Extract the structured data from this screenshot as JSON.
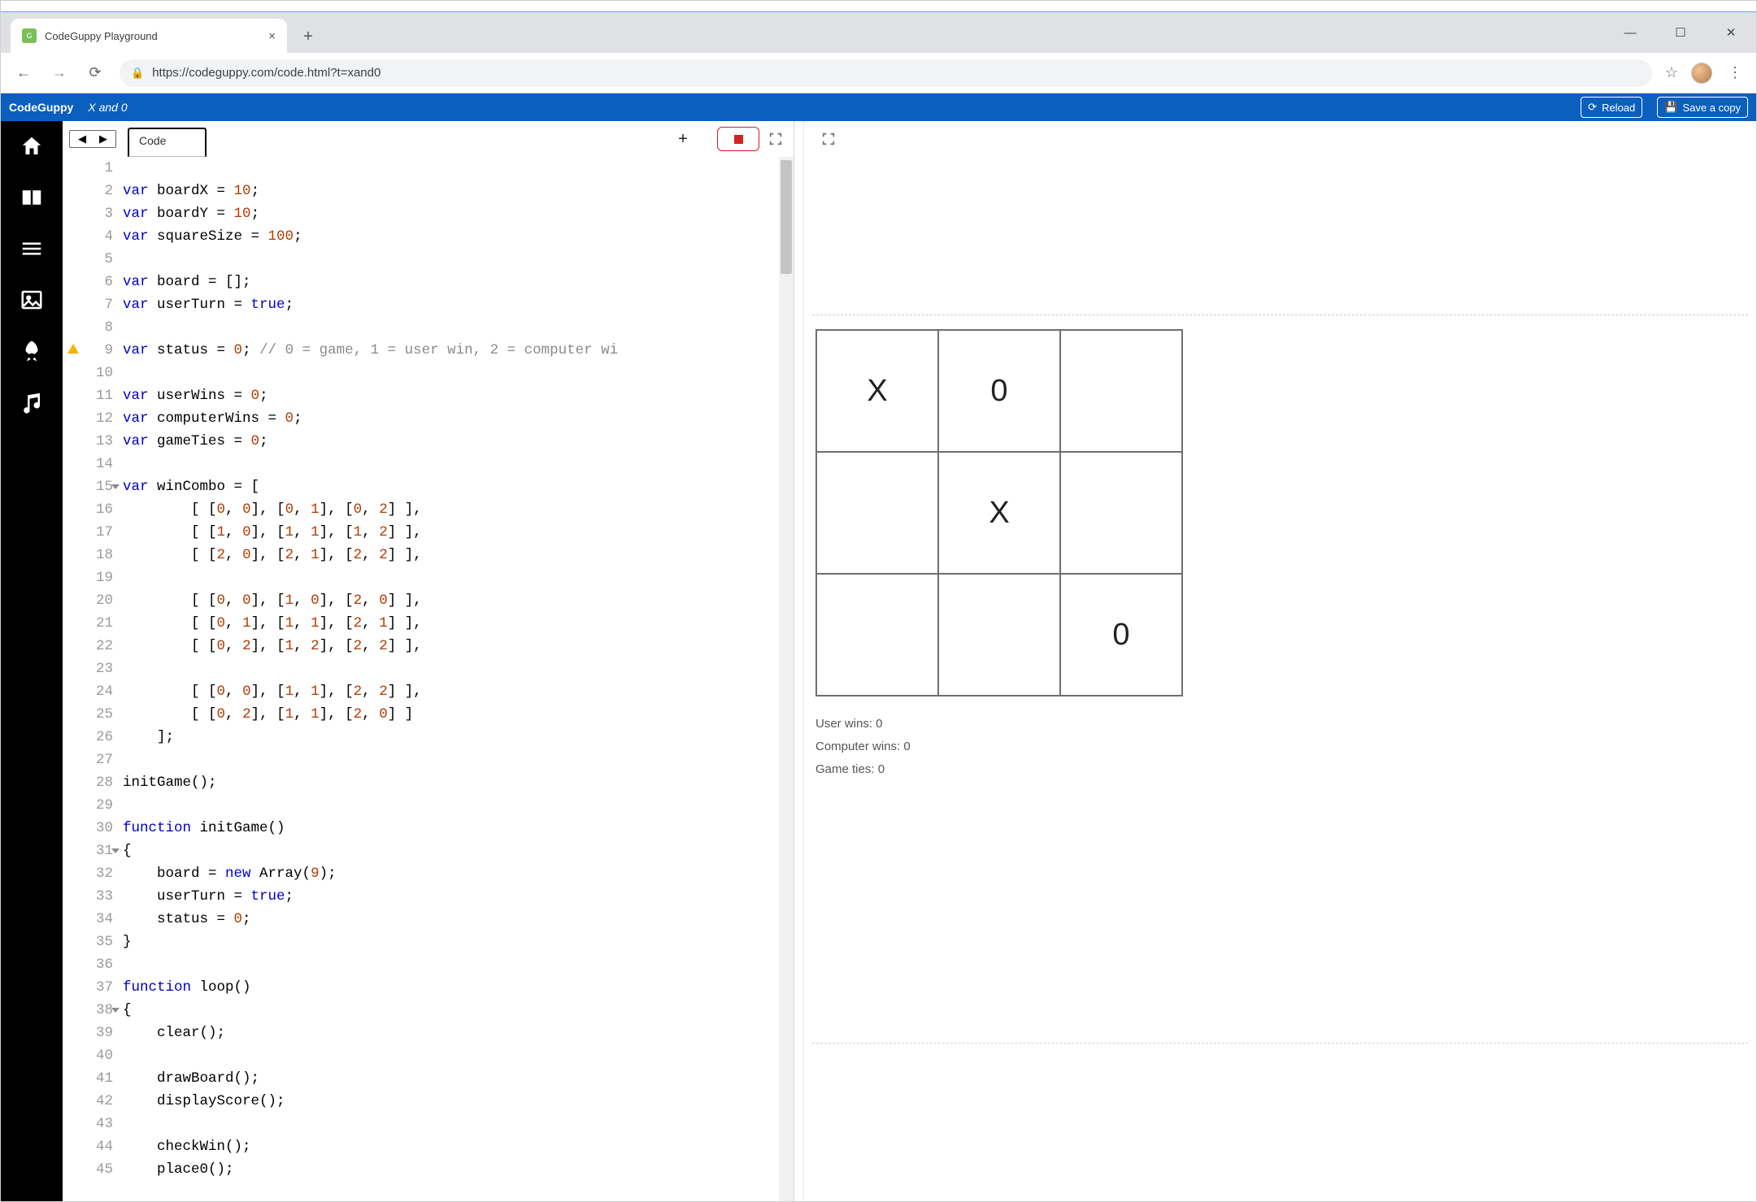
{
  "browser": {
    "tab_title": "CodeGuppy Playground",
    "url": "https://codeguppy.com/code.html?t=xand0"
  },
  "header": {
    "brand": "CodeGuppy",
    "project": "X and 0",
    "reload": "Reload",
    "save": "Save a copy"
  },
  "editor": {
    "tab_label": "Code",
    "lines": [
      "",
      "var boardX = 10;",
      "var boardY = 10;",
      "var squareSize = 100;",
      "",
      "var board = [];",
      "var userTurn = true;",
      "",
      "var status = 0; // 0 = game, 1 = user win, 2 = computer wi",
      "",
      "var userWins = 0;",
      "var computerWins = 0;",
      "var gameTies = 0;",
      "",
      "var winCombo = [",
      "        [ [0, 0], [0, 1], [0, 2] ],",
      "        [ [1, 0], [1, 1], [1, 2] ],",
      "        [ [2, 0], [2, 1], [2, 2] ],",
      "",
      "        [ [0, 0], [1, 0], [2, 0] ],",
      "        [ [0, 1], [1, 1], [2, 1] ],",
      "        [ [0, 2], [1, 2], [2, 2] ],",
      "",
      "        [ [0, 0], [1, 1], [2, 2] ],",
      "        [ [0, 2], [1, 1], [2, 0] ]",
      "    ];",
      "",
      "initGame();",
      "",
      "function initGame()",
      "{",
      "    board = new Array(9);",
      "    userTurn = true;",
      "    status = 0;",
      "}",
      "",
      "function loop()",
      "{",
      "    clear();",
      "",
      "    drawBoard();",
      "    displayScore();",
      "",
      "    checkWin();",
      "    place0();"
    ],
    "fold_lines": [
      15,
      31,
      38
    ],
    "warn_line": 9
  },
  "game": {
    "cells": [
      "X",
      "0",
      "",
      "",
      "X",
      "",
      "",
      "",
      "0"
    ],
    "score_user": "User wins: 0",
    "score_comp": "Computer wins: 0",
    "score_ties": "Game ties: 0"
  }
}
